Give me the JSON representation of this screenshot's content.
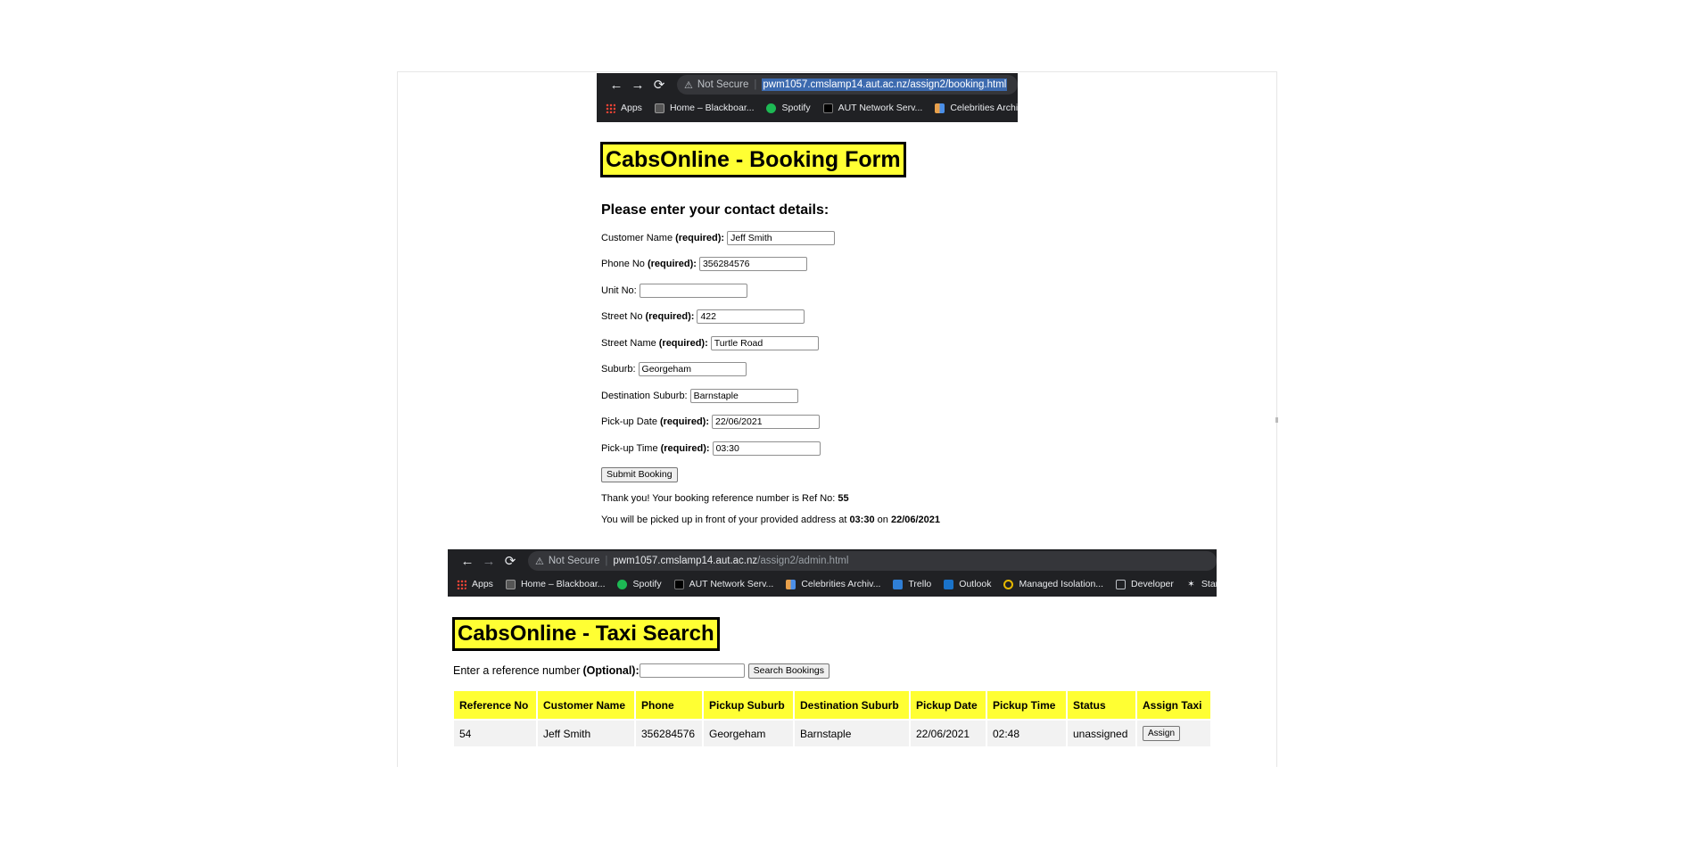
{
  "booking_browser": {
    "nav_back": "←",
    "nav_forward": "→",
    "nav_reload": "⟳",
    "security_icon": "⚠",
    "security_label": "Not Secure",
    "url": "pwm1057.cmslamp14.aut.ac.nz/assign2/booking.html",
    "bookmarks": [
      "Apps",
      "Home – Blackboar...",
      "Spotify",
      "AUT Network Serv...",
      "Celebrities Archi"
    ]
  },
  "booking": {
    "title": "CabsOnline - Booking Form",
    "subtitle": "Please enter your contact details:",
    "required_marker": "(required):",
    "fields": {
      "customer_name": {
        "label": "Customer Name",
        "required": true,
        "value": "Jeff Smith"
      },
      "phone": {
        "label": "Phone No",
        "required": true,
        "value": "356284576"
      },
      "unit": {
        "label": "Unit No:",
        "required": false,
        "value": ""
      },
      "street_no": {
        "label": "Street No",
        "required": true,
        "value": "422"
      },
      "street_name": {
        "label": "Street Name",
        "required": true,
        "value": "Turtle Road"
      },
      "suburb": {
        "label": "Suburb:",
        "required": false,
        "value": "Georgeham"
      },
      "destination": {
        "label": "Destination Suburb:",
        "required": false,
        "value": "Barnstaple"
      },
      "pickup_date": {
        "label": "Pick-up Date",
        "required": true,
        "value": "22/06/2021"
      },
      "pickup_time": {
        "label": "Pick-up Time",
        "required": true,
        "value": "03:30"
      }
    },
    "submit_label": "Submit Booking",
    "confirmation": {
      "thanks_text": "Thank you! Your booking reference number is Ref No:",
      "ref_no": "55",
      "pickup_prefix": "You will be picked up in front of your provided address at",
      "pickup_time": "03:30",
      "on_word": "on",
      "pickup_date": "22/06/2021"
    }
  },
  "admin_browser": {
    "nav_back": "←",
    "nav_forward": "→",
    "nav_reload": "⟳",
    "security_icon": "⚠",
    "security_label": "Not Secure",
    "url_host": "pwm1057.cmslamp14.aut.ac.nz",
    "url_path": "/assign2/admin.html",
    "bookmarks": [
      "Apps",
      "Home – Blackboar...",
      "Spotify",
      "AUT Network Serv...",
      "Celebrities Archiv...",
      "Trello",
      "Outlook",
      "Managed Isolation...",
      "Developer",
      "Startup Jobs"
    ]
  },
  "admin": {
    "title": "CabsOnline - Taxi Search",
    "search_label": "Enter a reference number",
    "search_optional": "(Optional):",
    "search_value": "",
    "search_button": "Search Bookings",
    "table": {
      "headers": [
        "Reference No",
        "Customer Name",
        "Phone",
        "Pickup Suburb",
        "Destination Suburb",
        "Pickup Date",
        "Pickup Time",
        "Status",
        "Assign Taxi"
      ],
      "rows": [
        {
          "ref": "54",
          "name": "Jeff Smith",
          "phone": "356284576",
          "pickup_suburb": "Georgeham",
          "destination": "Barnstaple",
          "date": "22/06/2021",
          "time": "02:48",
          "status": "unassigned",
          "action": "Assign"
        }
      ]
    }
  }
}
